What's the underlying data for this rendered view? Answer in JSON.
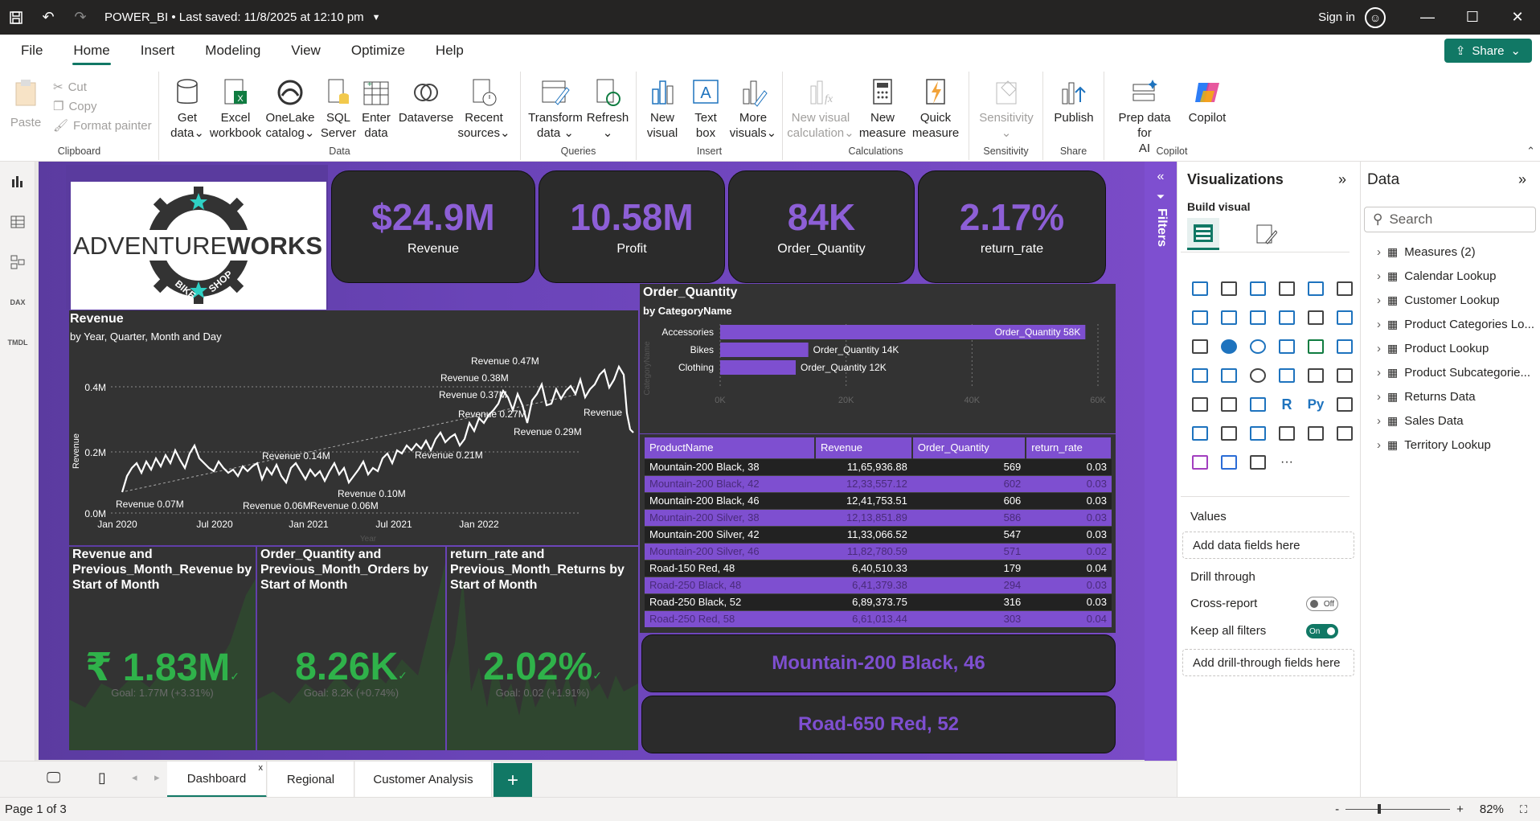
{
  "window": {
    "title": "POWER_BI",
    "saved": "Last saved: 11/8/2025 at 12:10 pm",
    "signin": "Sign in"
  },
  "menu": [
    "File",
    "Home",
    "Insert",
    "Modeling",
    "View",
    "Optimize",
    "Help"
  ],
  "share": "Share",
  "ribbon": {
    "clipboard": {
      "paste": "Paste",
      "cut": "Cut",
      "copy": "Copy",
      "format": "Format painter",
      "label": "Clipboard"
    },
    "data": {
      "get": [
        "Get",
        "data"
      ],
      "excel": [
        "Excel",
        "workbook"
      ],
      "onelake": [
        "OneLake",
        "catalog"
      ],
      "sql": [
        "SQL",
        "Server"
      ],
      "enter": [
        "Enter",
        "data"
      ],
      "dataverse": [
        "Dataverse",
        ""
      ],
      "recent": [
        "Recent",
        "sources"
      ],
      "label": "Data"
    },
    "queries": {
      "transform": [
        "Transform",
        "data"
      ],
      "refresh": [
        "Refresh",
        ""
      ],
      "label": "Queries"
    },
    "insert": {
      "newvisual": [
        "New",
        "visual"
      ],
      "textbox": [
        "Text",
        "box"
      ],
      "more": [
        "More",
        "visuals"
      ],
      "label": "Insert"
    },
    "calculations": {
      "newcalc": [
        "New visual",
        "calculation"
      ],
      "newmeasure": [
        "New",
        "measure"
      ],
      "quick": [
        "Quick",
        "measure"
      ],
      "label": "Calculations"
    },
    "sensitivity": {
      "btn": [
        "Sensitivity",
        ""
      ],
      "label": "Sensitivity"
    },
    "share": {
      "publish": [
        "Publish",
        ""
      ],
      "label": "Share"
    },
    "copilot": {
      "prep": [
        "Prep data for",
        "AI"
      ],
      "copilot": [
        "Copilot",
        ""
      ],
      "label": "Copilot"
    }
  },
  "kpis": [
    {
      "value": "$24.9M",
      "label": "Revenue"
    },
    {
      "value": "10.58M",
      "label": "Profit"
    },
    {
      "value": "84K",
      "label": "Order_Quantity"
    },
    {
      "value": "2.17%",
      "label": "return_rate"
    }
  ],
  "logo": {
    "text1": "ADVENTURE",
    "text2": "WORKS",
    "ring1": "BIKE",
    "ring2": "SHOP"
  },
  "revenue_chart": {
    "title": "Revenue",
    "subtitle": "by Year, Quarter, Month and Day",
    "ylabel": "Revenue",
    "xlabel": "Year",
    "yticks": [
      "0.4M",
      "0.2M",
      "0.0M"
    ],
    "xticks": [
      "Jan 2020",
      "Jul 2020",
      "Jan 2021",
      "Jul 2021",
      "Jan 2022"
    ],
    "labels": [
      "Revenue 0.47M",
      "Revenue 0.38M",
      "Revenue 0.37M",
      "Revenue 0.27M",
      "Revenue",
      "Revenue 0.29M",
      "Revenue 0.14M",
      "Revenue 0.21M",
      "Revenue 0.10M",
      "Revenue 0.07M",
      "Revenue 0.06M",
      "Revenue 0.06M"
    ]
  },
  "small_cards": [
    {
      "title": "Revenue and Previous_Month_Revenue by Start of Month",
      "value": "₹ 1.83M",
      "goal": "Goal: 1.77M (+3.31%)"
    },
    {
      "title": "Order_Quantity and Previous_Month_Orders by Start of Month",
      "value": "8.26K",
      "goal": "Goal: 8.2K (+0.74%)"
    },
    {
      "title": "return_rate and Previous_Month_Returns by Start of Month",
      "value": "2.02%",
      "goal": "Goal: 0.02 (+1.91%)"
    }
  ],
  "chart_data": {
    "type": "bar",
    "title": "Order_Quantity",
    "subtitle": "by CategoryName",
    "ylabel": "CategoryName",
    "categories": [
      "Accessories",
      "Bikes",
      "Clothing"
    ],
    "values": [
      58000,
      14000,
      12000
    ],
    "data_labels": [
      "Order_Quantity 58K",
      "Order_Quantity 14K",
      "Order_Quantity 12K"
    ],
    "xticks": [
      "0K",
      "20K",
      "40K",
      "60K"
    ],
    "xlim": [
      0,
      60000
    ]
  },
  "table": {
    "headers": [
      "ProductName",
      "Revenue",
      "Order_Quantity",
      "return_rate"
    ],
    "rows": [
      [
        "Mountain-200 Black, 38",
        "11,65,936.88",
        "569",
        "0.03"
      ],
      [
        "Mountain-200 Black, 42",
        "12,33,557.12",
        "602",
        "0.03"
      ],
      [
        "Mountain-200 Black, 46",
        "12,41,753.51",
        "606",
        "0.03"
      ],
      [
        "Mountain-200 Silver, 38",
        "12,13,851.89",
        "586",
        "0.03"
      ],
      [
        "Mountain-200 Silver, 42",
        "11,33,066.52",
        "547",
        "0.03"
      ],
      [
        "Mountain-200 Silver, 46",
        "11,82,780.59",
        "571",
        "0.02"
      ],
      [
        "Road-150 Red, 48",
        "6,40,510.33",
        "179",
        "0.04"
      ],
      [
        "Road-250 Black, 48",
        "6,41,379.38",
        "294",
        "0.03"
      ],
      [
        "Road-250 Black, 52",
        "6,89,373.75",
        "316",
        "0.03"
      ],
      [
        "Road-250 Red, 58",
        "6,61,013.44",
        "303",
        "0.04"
      ]
    ]
  },
  "name_cards": [
    "Mountain-200 Black, 46",
    "Road-650 Red, 52"
  ],
  "filters": "Filters",
  "visualizations": {
    "title": "Visualizations",
    "build": "Build visual",
    "values": "Values",
    "add_fields": "Add data fields here",
    "drill": "Drill through",
    "cross": "Cross-report",
    "cross_state": "Off",
    "keep": "Keep all filters",
    "keep_state": "On",
    "add_drill": "Add drill-through fields here"
  },
  "data_pane": {
    "title": "Data",
    "search": "Search",
    "items": [
      "Measures (2)",
      "Calendar Lookup",
      "Customer Lookup",
      "Product Categories Lo...",
      "Product Lookup",
      "Product Subcategorie...",
      "Returns Data",
      "Sales Data",
      "Territory Lookup"
    ]
  },
  "tabs": [
    "Dashboard",
    "Regional",
    "Customer Analysis"
  ],
  "status": {
    "page": "Page 1 of 3",
    "zoom": "82%"
  },
  "colors": {
    "accent": "#117865",
    "purple": "#7e4fd0",
    "green": "#2fb24a"
  }
}
